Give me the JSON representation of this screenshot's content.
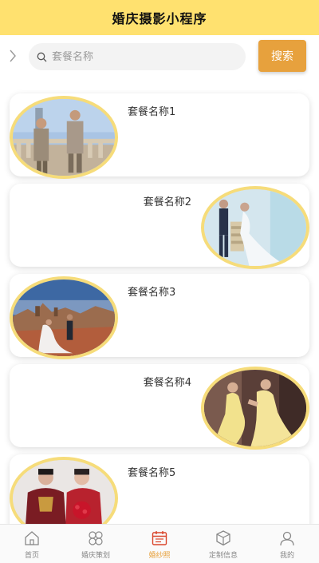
{
  "header": {
    "title": "婚庆摄影小程序"
  },
  "search": {
    "placeholder": "套餐名称",
    "value": "",
    "button_label": "搜索"
  },
  "packages": [
    {
      "name": "套餐名称1",
      "photo": "couple-on-balcony"
    },
    {
      "name": "套餐名称2",
      "photo": "couple-in-white-room"
    },
    {
      "name": "套餐名称3",
      "photo": "couple-on-hilltop"
    },
    {
      "name": "套餐名称4",
      "photo": "bride-in-yellow-gown"
    },
    {
      "name": "套餐名称5",
      "photo": "couple-in-red-traditional-dress"
    }
  ],
  "tabbar": {
    "items": [
      {
        "label": "首页",
        "icon": "home-icon"
      },
      {
        "label": "婚庆策划",
        "icon": "clover-icon"
      },
      {
        "label": "婚纱照",
        "icon": "calendar-icon"
      },
      {
        "label": "定制信息",
        "icon": "box-icon"
      },
      {
        "label": "我的",
        "icon": "user-icon"
      }
    ],
    "active_index": 2
  },
  "colors": {
    "header": "#ffe16f",
    "accent": "#e7a13d",
    "photo_border": "#f6dc7a"
  }
}
